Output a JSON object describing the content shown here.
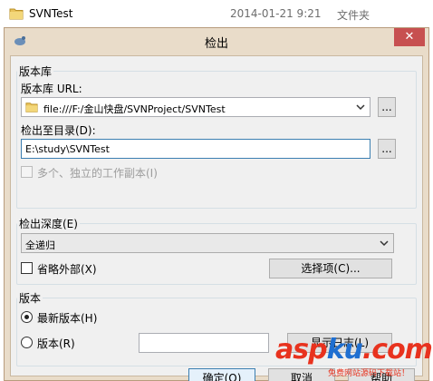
{
  "explorer": {
    "folder_name": "SVNTest",
    "date": "2014-01-21 9:21",
    "type": "文件夹"
  },
  "dialog": {
    "title": "检出",
    "close_glyph": "✕"
  },
  "repository": {
    "group_title": "版本库",
    "url_label": "版本库 URL:",
    "url_value": "file:///F:/金山快盘/SVNProject/SVNTest",
    "url_browse": "...",
    "dir_label": "检出至目录(D):",
    "dir_value": "E:\\study\\SVNTest",
    "dir_browse": "...",
    "multi_wc_label": "多个、独立的工作副本(I)"
  },
  "depth": {
    "group_title": "检出深度(E)",
    "depth_value": "全递归",
    "omit_externals_label": "省略外部(X)",
    "choose_items_button": "选择项(C)..."
  },
  "revision": {
    "group_title": "版本",
    "head_label": "最新版本(H)",
    "rev_label": "版本(R)",
    "rev_value": "",
    "show_log_button": "显示日志(L)"
  },
  "buttons": {
    "ok": "确定(O)",
    "cancel": "取消",
    "help": "帮助"
  },
  "watermark": {
    "brand_a": "asp",
    "brand_b": "ku",
    "brand_c": ".com",
    "sub": "免费网站源码下载站！"
  },
  "colors": {
    "dialog_frame": "#e9dcc9",
    "close_button": "#c75050",
    "focus_border": "#3c7fb1",
    "watermark_red": "#e8321e",
    "watermark_blue": "#1f6fd1"
  }
}
